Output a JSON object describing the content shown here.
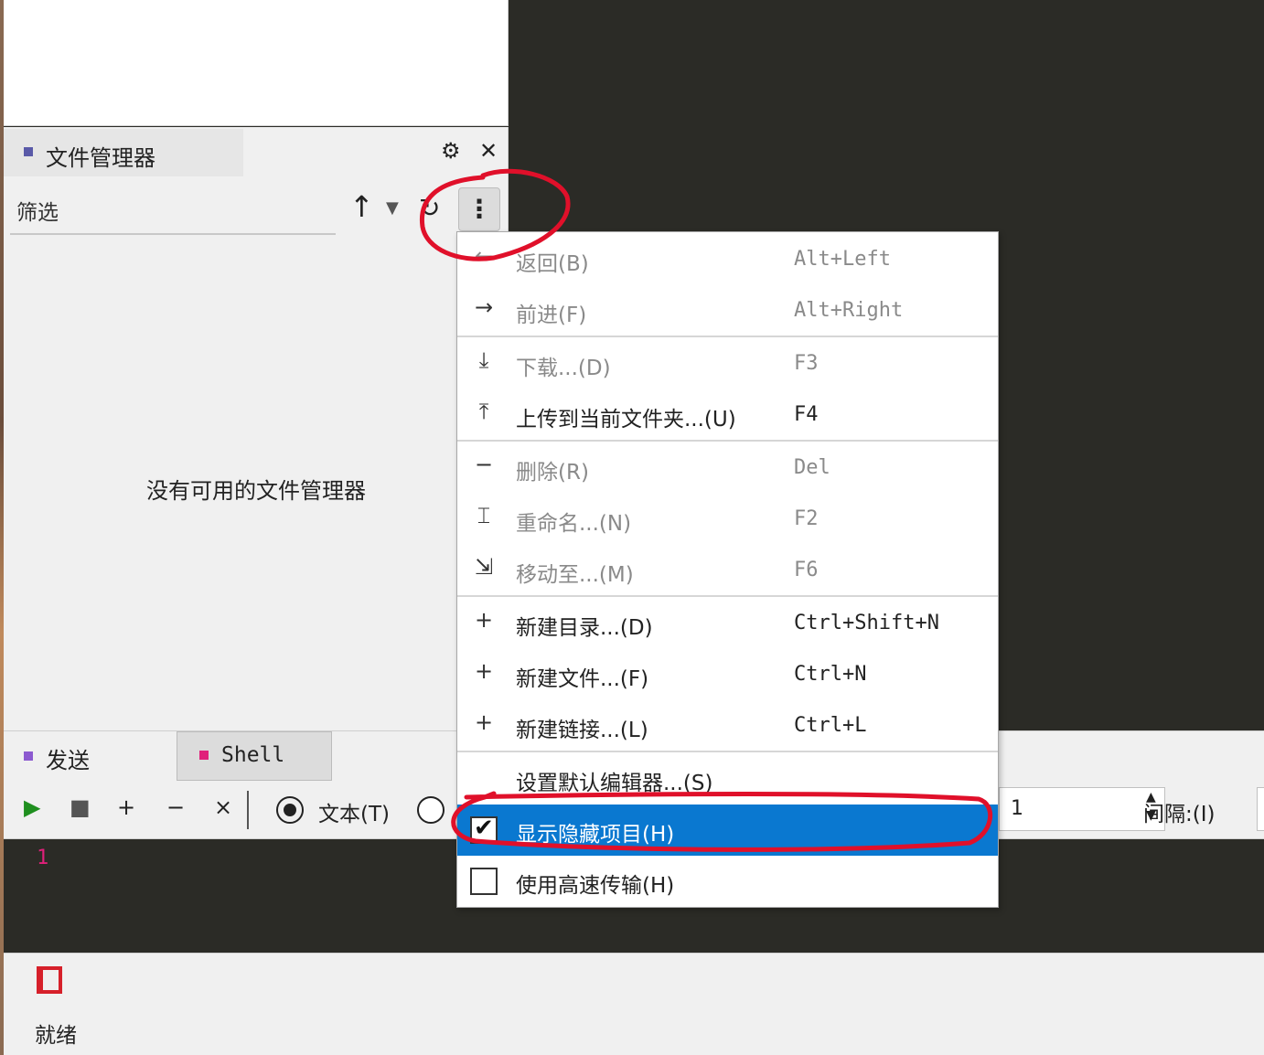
{
  "file_manager": {
    "tab_label": "文件管理器",
    "gear_icon": "⚙",
    "close_icon": "✕",
    "filter_label": "筛选",
    "empty_text": "没有可用的文件管理器"
  },
  "bottom_tabs": {
    "send_label": "发送",
    "shell_label": "Shell"
  },
  "toolbar": {
    "radio_text_label": "文本(T)",
    "count_value": "1",
    "interval_label": "间隔:(I)"
  },
  "editor": {
    "line_number": "1"
  },
  "status": {
    "text": "就绪"
  },
  "menu": {
    "items": [
      {
        "label": "返回(B)",
        "shortcut": "Alt+Left",
        "icon": "back-arrow-icon"
      },
      {
        "label": "前进(F)",
        "shortcut": "Alt+Right",
        "icon": "forward-arrow-icon"
      },
      {
        "label": "下载...(D)",
        "shortcut": "F3",
        "icon": "download-icon"
      },
      {
        "label": "上传到当前文件夹...(U)",
        "shortcut": "F4",
        "icon": "upload-icon"
      },
      {
        "label": "删除(R)",
        "shortcut": "Del",
        "icon": "minus-icon"
      },
      {
        "label": "重命名...(N)",
        "shortcut": "F2",
        "icon": "rename-icon"
      },
      {
        "label": "移动至...(M)",
        "shortcut": "F6",
        "icon": "move-icon"
      },
      {
        "label": "新建目录...(D)",
        "shortcut": "Ctrl+Shift+N",
        "icon": "plus-icon"
      },
      {
        "label": "新建文件...(F)",
        "shortcut": "Ctrl+N",
        "icon": "plus-icon"
      },
      {
        "label": "新建链接...(L)",
        "shortcut": "Ctrl+L",
        "icon": "plus-icon"
      },
      {
        "label": "设置默认编辑器...(S)",
        "shortcut": ""
      },
      {
        "label": "显示隐藏项目(H)",
        "shortcut": "",
        "checked": true
      },
      {
        "label": "使用高速传输(H)",
        "shortcut": "",
        "checked": false
      }
    ]
  },
  "colors": {
    "highlight": "#0a78d0",
    "annotation": "#e0102a"
  }
}
